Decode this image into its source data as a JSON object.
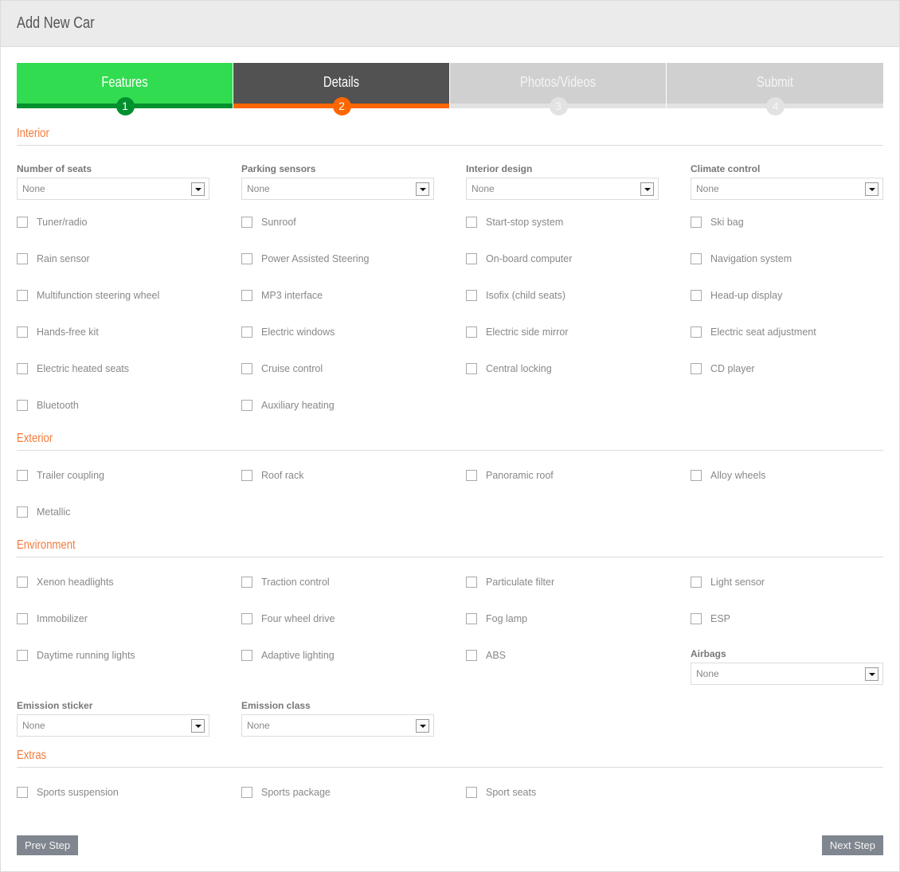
{
  "header": {
    "title": "Add New Car"
  },
  "steps": [
    {
      "label": "Features",
      "number": "1",
      "state": "done"
    },
    {
      "label": "Details",
      "number": "2",
      "state": "active"
    },
    {
      "label": "Photos/Videos",
      "number": "3",
      "state": "todo"
    },
    {
      "label": "Submit",
      "number": "4",
      "state": "todo"
    }
  ],
  "colors": {
    "accent": "#ff6600",
    "done": "#32dc50",
    "done_dark": "#00902e",
    "active": "#525252",
    "section_title": "#f47b3b"
  },
  "interior": {
    "title": "Interior",
    "selects": [
      {
        "label": "Number of seats",
        "value": "None"
      },
      {
        "label": "Parking sensors",
        "value": "None"
      },
      {
        "label": "Interior design",
        "value": "None"
      },
      {
        "label": "Climate control",
        "value": "None"
      }
    ],
    "checkboxes": [
      [
        "Tuner/radio",
        "Sunroof",
        "Start-stop system",
        "Ski bag"
      ],
      [
        "Rain sensor",
        "Power Assisted Steering",
        "On-board computer",
        "Navigation system"
      ],
      [
        "Multifunction steering wheel",
        "MP3 interface",
        "Isofix (child seats)",
        "Head-up display"
      ],
      [
        "Hands-free kit",
        "Electric windows",
        "Electric side mirror",
        "Electric seat adjustment"
      ],
      [
        "Electric heated seats",
        "Cruise control",
        "Central locking",
        "CD player"
      ],
      [
        "Bluetooth",
        "Auxiliary heating"
      ]
    ]
  },
  "exterior": {
    "title": "Exterior",
    "checkboxes": [
      [
        "Trailer coupling",
        "Roof rack",
        "Panoramic roof",
        "Alloy wheels"
      ],
      [
        "Metallic"
      ]
    ]
  },
  "environment": {
    "title": "Environment",
    "checkboxes": [
      [
        "Xenon headlights",
        "Traction control",
        "Particulate filter",
        "Light sensor"
      ],
      [
        "Immobilizer",
        "Four wheel drive",
        "Fog lamp",
        "ESP"
      ],
      [
        "Daytime running lights",
        "Adaptive lighting",
        "ABS"
      ]
    ],
    "airbags": {
      "label": "Airbags",
      "value": "None"
    },
    "selects": [
      {
        "label": "Emission sticker",
        "value": "None"
      },
      {
        "label": "Emission class",
        "value": "None"
      }
    ]
  },
  "extras": {
    "title": "Extras",
    "checkboxes": [
      [
        "Sports suspension",
        "Sports package",
        "Sport seats"
      ]
    ]
  },
  "footer": {
    "prev_label": "Prev Step",
    "next_label": "Next Step"
  }
}
